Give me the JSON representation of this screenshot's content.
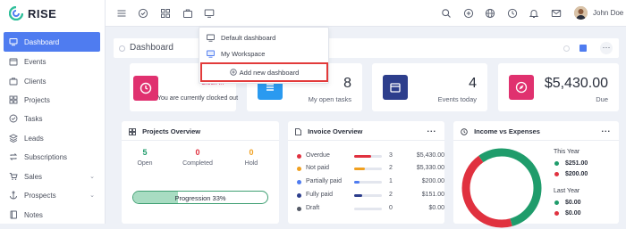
{
  "app": {
    "name": "RISE"
  },
  "sidebar": {
    "items": [
      {
        "label": "Dashboard",
        "icon": "monitor-icon"
      },
      {
        "label": "Events",
        "icon": "calendar-icon"
      },
      {
        "label": "Clients",
        "icon": "briefcase-icon"
      },
      {
        "label": "Projects",
        "icon": "grid-icon"
      },
      {
        "label": "Tasks",
        "icon": "check-circle-icon"
      },
      {
        "label": "Leads",
        "icon": "layers-icon"
      },
      {
        "label": "Subscriptions",
        "icon": "repeat-icon"
      },
      {
        "label": "Sales",
        "icon": "cart-icon"
      },
      {
        "label": "Prospects",
        "icon": "anchor-icon"
      },
      {
        "label": "Notes",
        "icon": "book-icon"
      }
    ]
  },
  "topbar": {
    "user_name": "John Doe"
  },
  "page": {
    "title": "Dashboard"
  },
  "dropdown": {
    "items": [
      "Default dashboard",
      "My Workspace"
    ],
    "add_label": "Add new dashboard"
  },
  "stats": {
    "clock": {
      "action": "Clock In",
      "text": "You are currently clocked out"
    },
    "tasks": {
      "value": "8",
      "label": "My open tasks"
    },
    "events": {
      "value": "4",
      "label": "Events today"
    },
    "due": {
      "value": "$5,430.00",
      "label": "Due"
    }
  },
  "projects_overview": {
    "title": "Projects Overview",
    "columns": [
      {
        "value": "5",
        "label": "Open",
        "color": "#1f9c6b"
      },
      {
        "value": "0",
        "label": "Completed",
        "color": "#e0313f"
      },
      {
        "value": "0",
        "label": "Hold",
        "color": "#f0a020"
      }
    ],
    "progress_label": "Progression 33%",
    "progress": 0.33
  },
  "invoice_overview": {
    "title": "Invoice Overview",
    "more": "...",
    "rows": [
      {
        "label": "Overdue",
        "count": "3",
        "amount": "$5,430.00",
        "color": "#e0313f",
        "fill": 0.6
      },
      {
        "label": "Not paid",
        "count": "2",
        "amount": "$5,330.00",
        "color": "#f0a020",
        "fill": 0.4
      },
      {
        "label": "Partially paid",
        "count": "1",
        "amount": "$200.00",
        "color": "#4f7cf0",
        "fill": 0.2
      },
      {
        "label": "Fully paid",
        "count": "2",
        "amount": "$151.00",
        "color": "#2d3e8c",
        "fill": 0.3
      },
      {
        "label": "Draft",
        "count": "0",
        "amount": "$0.00",
        "color": "#555a66",
        "fill": 0
      }
    ]
  },
  "income_expenses": {
    "title": "Income vs Expenses",
    "more": "...",
    "this_year_label": "This Year",
    "this_year": [
      {
        "amount": "$251.00",
        "color": "#1f9c6b"
      },
      {
        "amount": "$200.00",
        "color": "#e0313f"
      }
    ],
    "last_year_label": "Last Year",
    "last_year": [
      {
        "amount": "$0.00",
        "color": "#1f9c6b"
      },
      {
        "amount": "$0.00",
        "color": "#e0313f"
      }
    ],
    "donut": {
      "income": 251,
      "expenses": 200
    }
  },
  "colors": {
    "accent": "#4f7cf0",
    "clock": "#e0316f",
    "tasks": "#2a9af0",
    "events": "#2d3e8c",
    "due": "#e0316f"
  }
}
